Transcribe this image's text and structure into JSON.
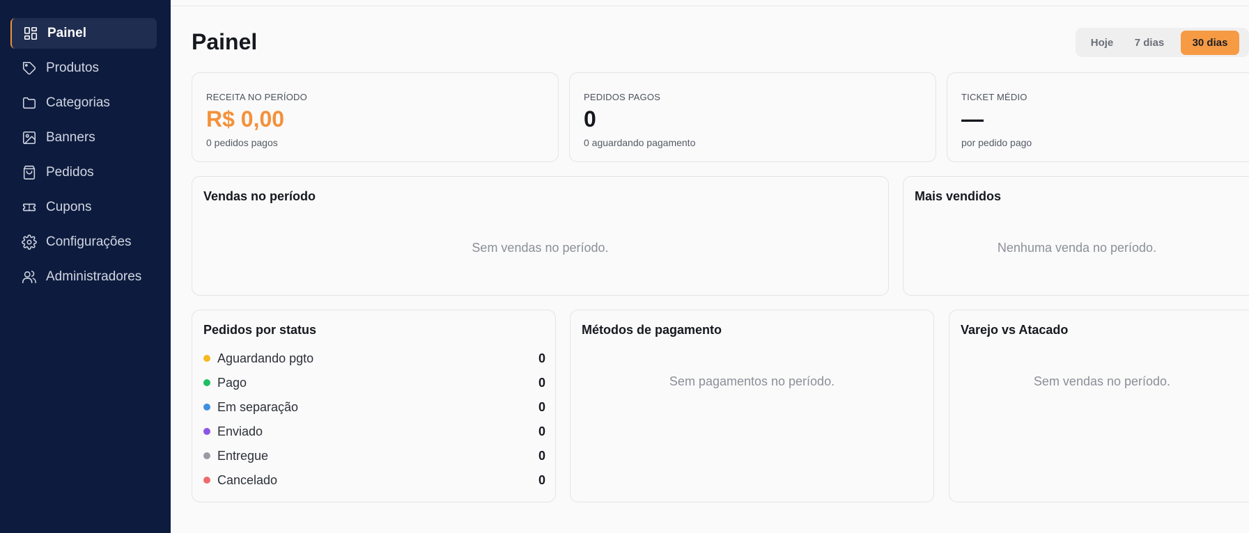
{
  "sidebar": {
    "items": [
      {
        "label": "Painel",
        "icon": "dashboard-icon",
        "active": true
      },
      {
        "label": "Produtos",
        "icon": "tag-icon"
      },
      {
        "label": "Categorias",
        "icon": "folder-icon"
      },
      {
        "label": "Banners",
        "icon": "image-icon"
      },
      {
        "label": "Pedidos",
        "icon": "shopping-bag-icon"
      },
      {
        "label": "Cupons",
        "icon": "ticket-icon"
      },
      {
        "label": "Configurações",
        "icon": "gear-icon"
      },
      {
        "label": "Administradores",
        "icon": "users-icon"
      }
    ]
  },
  "header": {
    "title": "Painel",
    "ranges": [
      "Hoje",
      "7 dias",
      "30 dias"
    ],
    "selected_range": "30 dias"
  },
  "stats": [
    {
      "label": "RECEITA NO PERÍODO",
      "value": "R$ 0,00",
      "sub": "0 pedidos pagos"
    },
    {
      "label": "PEDIDOS PAGOS",
      "value": "0",
      "sub": "0 aguardando pagamento"
    },
    {
      "label": "TICKET MÉDIO",
      "value": "—",
      "sub": "por pedido pago"
    }
  ],
  "sales_period": {
    "title": "Vendas no período",
    "empty": "Sem vendas no período."
  },
  "best_sellers": {
    "title": "Mais vendidos",
    "empty": "Nenhuma venda no período."
  },
  "orders_by_status": {
    "title": "Pedidos por status",
    "rows": [
      {
        "label": "Aguardando pgto",
        "count": "0",
        "color": "#f5b921"
      },
      {
        "label": "Pago",
        "count": "0",
        "color": "#1fbf64"
      },
      {
        "label": "Em separação",
        "count": "0",
        "color": "#3f8fe0"
      },
      {
        "label": "Enviado",
        "count": "0",
        "color": "#8b55e6"
      },
      {
        "label": "Entregue",
        "count": "0",
        "color": "#9a9ca3"
      },
      {
        "label": "Cancelado",
        "count": "0",
        "color": "#ef6b6b"
      }
    ]
  },
  "payment_methods": {
    "title": "Métodos de pagamento",
    "empty": "Sem pagamentos no período."
  },
  "retail_wholesale": {
    "title": "Varejo vs Atacado",
    "empty": "Sem vendas no período."
  },
  "colors": {
    "sidebar_bg": "#0d1b3e",
    "accent": "#f4913a"
  }
}
